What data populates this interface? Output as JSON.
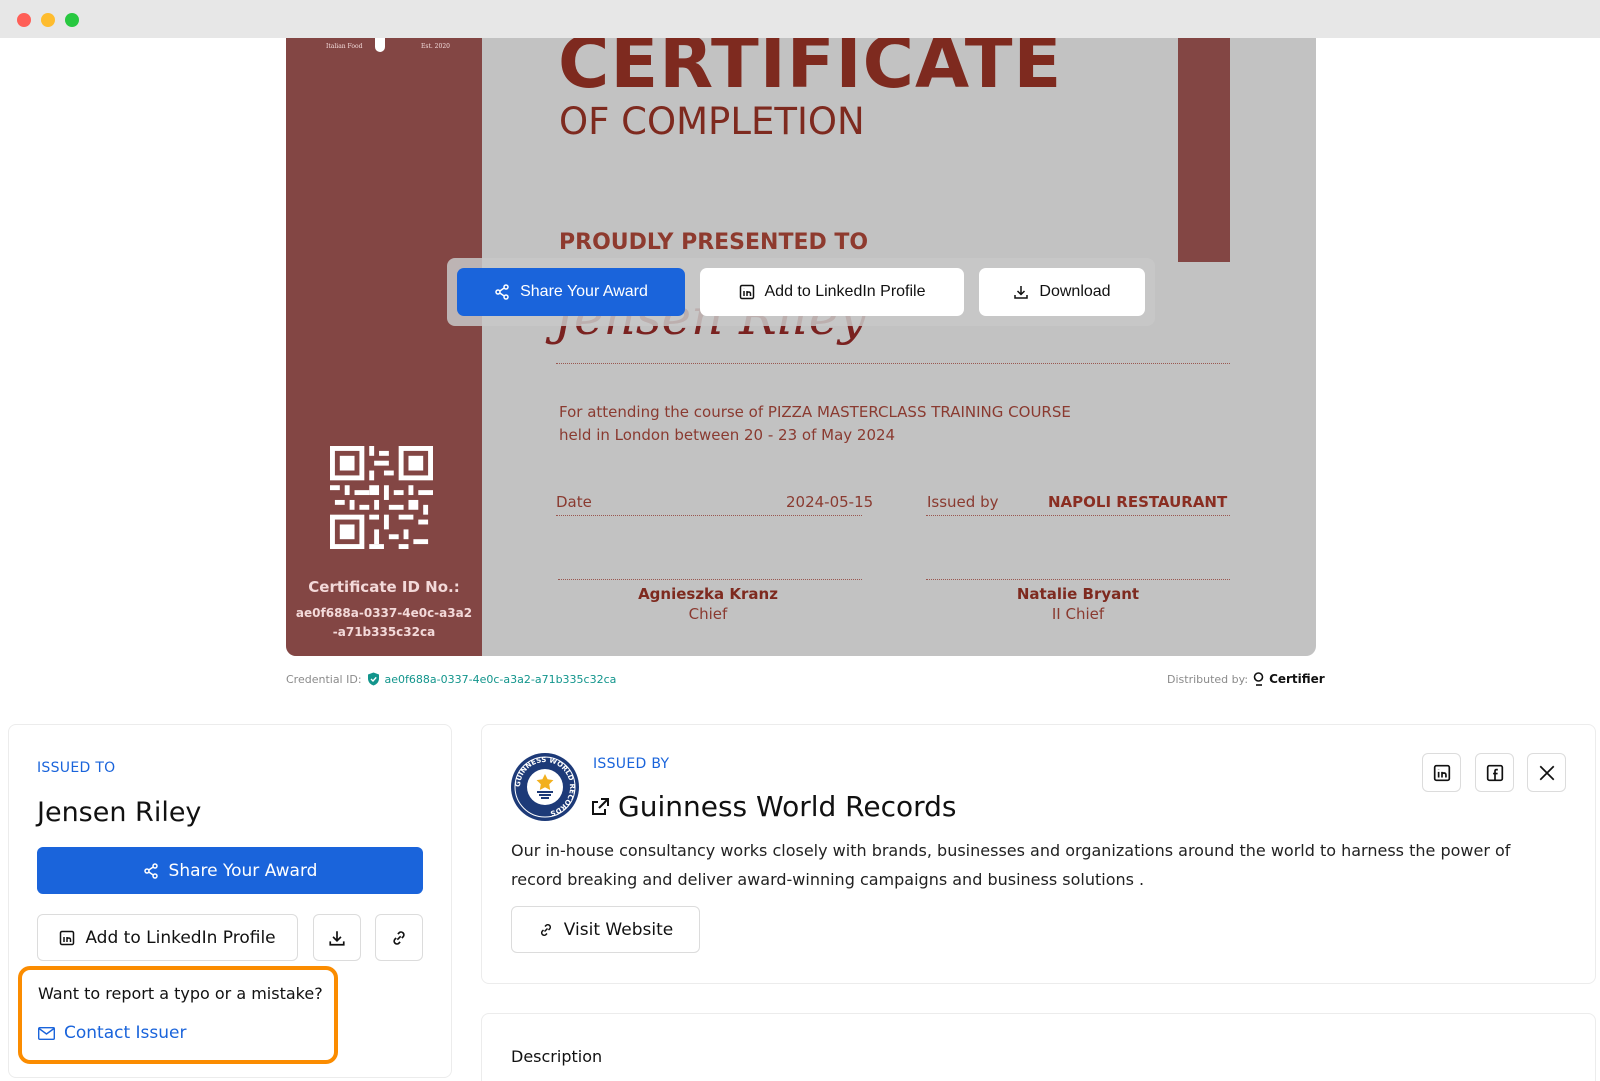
{
  "certificate": {
    "logo_left_text": "Italian Food",
    "logo_right_text": "Est. 2020",
    "title": "CERTIFICATE",
    "subtitle": "OF COMPLETION",
    "presented_to": "PROUDLY PRESENTED TO",
    "recipient_signature": "Jensen Riley",
    "course_line1": "For attending the course of PIZZA MASTERCLASS TRAINING COURSE",
    "course_line2": "held in London between 20  - 23 of May 2024",
    "date_label": "Date",
    "date_value": "2024-05-15",
    "issued_by_label": "Issued by",
    "issued_by_value": "NAPOLI RESTAURANT",
    "signer1_name": "Agnieszka Kranz",
    "signer1_role": "Chief",
    "signer2_name": "Natalie Bryant",
    "signer2_role": "II Chief",
    "id_label": "Certificate ID No.:",
    "id_value": "ae0f688a-0337-4e0c-a3a2-a71b335c32ca"
  },
  "overlay": {
    "share": "Share Your Award",
    "linkedin": "Add to LinkedIn Profile",
    "download": "Download"
  },
  "meta": {
    "credential_label": "Credential ID:",
    "credential_value": "ae0f688a-0337-4e0c-a3a2-a71b335c32ca",
    "distributed_label": "Distributed by:",
    "distributed_brand": "Certifier"
  },
  "issued_to": {
    "label": "ISSUED TO",
    "name": "Jensen Riley",
    "share": "Share Your Award",
    "linkedin": "Add to LinkedIn Profile",
    "report_question": "Want to report a typo or a mistake?",
    "contact": "Contact Issuer"
  },
  "issued_by": {
    "label": "ISSUED BY",
    "name": "Guinness World Records",
    "description": "Our in-house consultancy works closely with brands, businesses and organizations around the world to harness the power of record breaking and deliver award-winning campaigns and business solutions .",
    "visit": "Visit Website",
    "logo_text": "GUINNESS WORLD RECORDS"
  },
  "description": {
    "title": "Description"
  },
  "colors": {
    "accent": "#1a64db",
    "certificate_maroon": "#834644",
    "highlight": "#fb8c00"
  }
}
